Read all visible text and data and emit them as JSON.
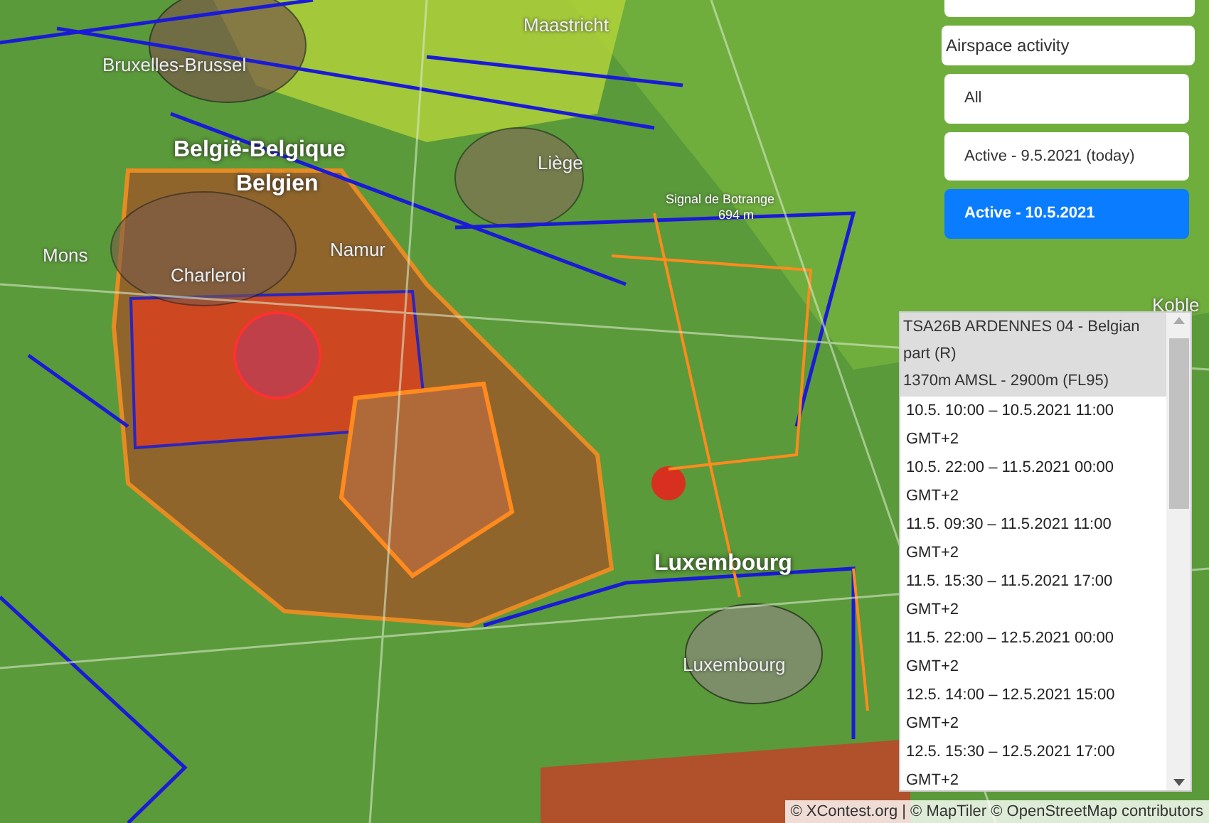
{
  "map": {
    "labels": [
      {
        "text": "Bruxelles-Brussel",
        "kind": "city"
      },
      {
        "text": "Maastricht",
        "kind": "city"
      },
      {
        "text": "België-Belgique",
        "kind": "country"
      },
      {
        "text": "Belgien",
        "kind": "country"
      },
      {
        "text": "Liège",
        "kind": "city"
      },
      {
        "text": "Mons",
        "kind": "city"
      },
      {
        "text": "Charleroi",
        "kind": "city"
      },
      {
        "text": "Namur",
        "kind": "city"
      },
      {
        "text": "Signal de Botrange",
        "kind": "peak"
      },
      {
        "text": "694 m",
        "kind": "peak"
      },
      {
        "text": "Luxembourg",
        "kind": "country"
      },
      {
        "text": "Luxembourg",
        "kind": "city"
      },
      {
        "text": "Koble",
        "kind": "city"
      }
    ]
  },
  "activity_menu": {
    "title": "Airspace activity",
    "options": [
      {
        "label": "All",
        "selected": false
      },
      {
        "label": "Active - 9.5.2021 (today)",
        "selected": false
      },
      {
        "label": "Active - 10.5.2021",
        "selected": true
      }
    ]
  },
  "airspace_popup": {
    "name": "TSA26B ARDENNES 04 - Belgian part (R)",
    "limits": "1370m AMSL - 2900m (FL95)",
    "periods": [
      "10.5. 10:00 – 10.5.2021 11:00 GMT+2",
      "10.5. 22:00 – 11.5.2021 00:00 GMT+2",
      "11.5. 09:30 – 11.5.2021 11:00 GMT+2",
      "11.5. 15:30 – 11.5.2021 17:00 GMT+2",
      "11.5. 22:00 – 12.5.2021 00:00 GMT+2",
      "12.5. 14:00 – 12.5.2021 15:00 GMT+2",
      "12.5. 15:30 – 12.5.2021 17:00 GMT+2"
    ]
  },
  "attribution": "© XContest.org | © MapTiler © OpenStreetMap contributors"
}
